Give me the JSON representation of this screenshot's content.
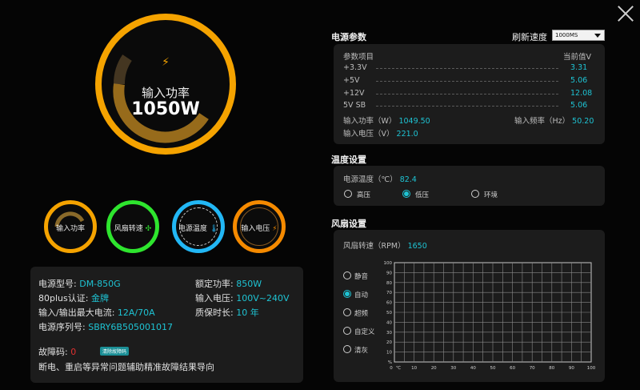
{
  "gauge_main": {
    "label": "输入功率",
    "value": "1050W",
    "ring_color": "#f5a300"
  },
  "small_gauges": [
    {
      "label": "输入功率",
      "color": "#f5a300"
    },
    {
      "label": "风扇转速",
      "color": "#2ee52e"
    },
    {
      "label": "电源温度",
      "color": "#22b7f5"
    },
    {
      "label": "输入电压",
      "color": "#f58a00"
    }
  ],
  "info": {
    "model_label": "电源型号:",
    "model": "DM-850G",
    "cert_label": "80plus认证:",
    "cert": "金牌",
    "max_current_label": "输入/输出最大电流:",
    "max_current": "12A/70A",
    "serial_label": "电源序列号:",
    "serial": "SBRY6B505001017",
    "rated_label": "额定功率:",
    "rated": "850W",
    "voltage_label": "输入电压:",
    "voltage": "100V~240V",
    "warranty_label": "质保时长:",
    "warranty": "10 年",
    "fault_label": "故障码:",
    "fault": "0",
    "fault_button": "清除故障码",
    "fault_desc": "断电、重启等异常问题辅助精准故障结果导向"
  },
  "power_params": {
    "title": "电源参数",
    "refresh_label": "刷新速度",
    "refresh_value": "1000MS",
    "col_item": "参数项目",
    "col_value": "当前值V",
    "rows": [
      {
        "name": "+3.3V",
        "value": "3.31"
      },
      {
        "name": "+5V",
        "value": "5.06"
      },
      {
        "name": "+12V",
        "value": "12.08"
      },
      {
        "name": "5V SB",
        "value": "5.06"
      }
    ],
    "input_power_label": "输入功率（W）",
    "input_power": "1049.50",
    "input_freq_label": "输入频率（Hz）",
    "input_freq": "50.20",
    "input_voltage_label": "输入电压（V）",
    "input_voltage": "221.0"
  },
  "temp": {
    "title": "温度设置",
    "label": "电源温度（℃）",
    "value": "82.4",
    "options": [
      "高压",
      "低压",
      "环境"
    ],
    "selected": 1
  },
  "fan": {
    "title": "风扇设置",
    "speed_label": "风扇转速（RPM）",
    "speed": "1650",
    "modes": [
      "静音",
      "自动",
      "超频",
      "自定义",
      "清灰"
    ],
    "selected": 1,
    "y_ticks": [
      "100",
      "90",
      "80",
      "70",
      "60",
      "50",
      "40",
      "30",
      "20",
      "10",
      "%"
    ],
    "x_ticks": [
      "0",
      "℃",
      "10",
      "20",
      "30",
      "40",
      "50",
      "60",
      "70",
      "80",
      "90",
      "100"
    ]
  }
}
